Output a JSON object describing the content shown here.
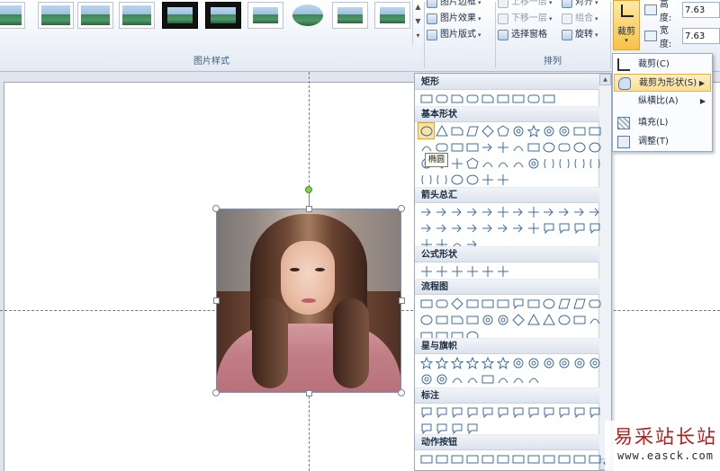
{
  "ribbon": {
    "picture_styles_group_label": "图片样式",
    "picture_border_label": "图片边框",
    "picture_effects_label": "图片效果",
    "picture_layout_label": "图片版式",
    "bring_forward_label": "上移一层",
    "send_backward_label": "下移一层",
    "selection_pane_label": "选择窗格",
    "align_label": "对齐",
    "group_label": "组合",
    "rotate_label": "旋转",
    "arrange_group_label": "排列",
    "crop_label": "裁剪",
    "height_label": "高度:",
    "height_value": "7.63",
    "width_label": "宽度:",
    "width_value": "7.63",
    "style_thumbnails": [
      "simple-frame",
      "soft-edge",
      "reflected",
      "reflected-soft",
      "thick-black-frame",
      "black-frame",
      "plain-frame",
      "oval",
      "double-frame",
      "black-shadow-frame"
    ]
  },
  "crop_menu": {
    "items": [
      {
        "label": "裁剪(C)",
        "icon": "crop-icon"
      },
      {
        "label": "裁剪为形状(S)",
        "icon": "crop-to-shape-icon",
        "has_submenu": true,
        "active": true
      },
      {
        "label": "纵横比(A)",
        "icon": "",
        "has_submenu": true
      },
      {
        "label": "填充(L)",
        "icon": "fill-icon"
      },
      {
        "label": "调整(T)",
        "icon": "fit-icon"
      }
    ]
  },
  "shapes_panel": {
    "categories": [
      {
        "label": "矩形",
        "count": 9
      },
      {
        "label": "基本形状",
        "count": 42
      },
      {
        "label": "箭头总汇",
        "count": 28
      },
      {
        "label": "公式形状",
        "count": 6
      },
      {
        "label": "流程图",
        "count": 28
      },
      {
        "label": "星与旗帜",
        "count": 20
      },
      {
        "label": "标注",
        "count": 16
      },
      {
        "label": "动作按钮",
        "count": 12
      }
    ],
    "selected_shape": "椭圆",
    "tooltip": "椭圆"
  },
  "watermark": {
    "title": "易采站长站",
    "url": "www.easck.com"
  },
  "colors": {
    "accent": "#f7c243",
    "ribbon_bg": "#eef3f9",
    "shape_stroke": "#3f6c9e",
    "watermark_red": "#b91c1c"
  }
}
